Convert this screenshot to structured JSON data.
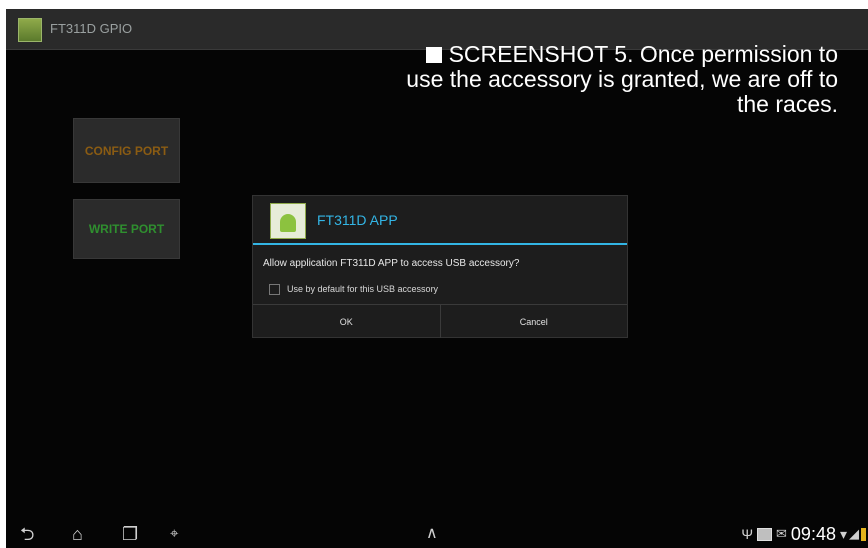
{
  "app": {
    "title": "FT311D GPIO"
  },
  "caption": {
    "text": "SCREENSHOT 5. Once permission to use the accessory is granted, we are off to the races."
  },
  "buttons": {
    "config": "CONFIG PORT",
    "write": "WRITE PORT"
  },
  "dialog": {
    "title": "FT311D APP",
    "message": "Allow application FT311D APP to access USB accessory?",
    "checkbox_label": "Use by default for this USB accessory",
    "checkbox_checked": false,
    "ok": "OK",
    "cancel": "Cancel"
  },
  "status": {
    "time": "09:48"
  },
  "icons": {
    "back": "back-icon",
    "home": "home-icon",
    "recent": "recent-apps-icon",
    "screenshot": "screenshot-icon",
    "up": "chevron-up-icon"
  },
  "colors": {
    "dialog_accent": "#33b5e5",
    "config_label": "#8b5c13",
    "write_label": "#2f8f2f",
    "battery": "#e3b21c"
  }
}
